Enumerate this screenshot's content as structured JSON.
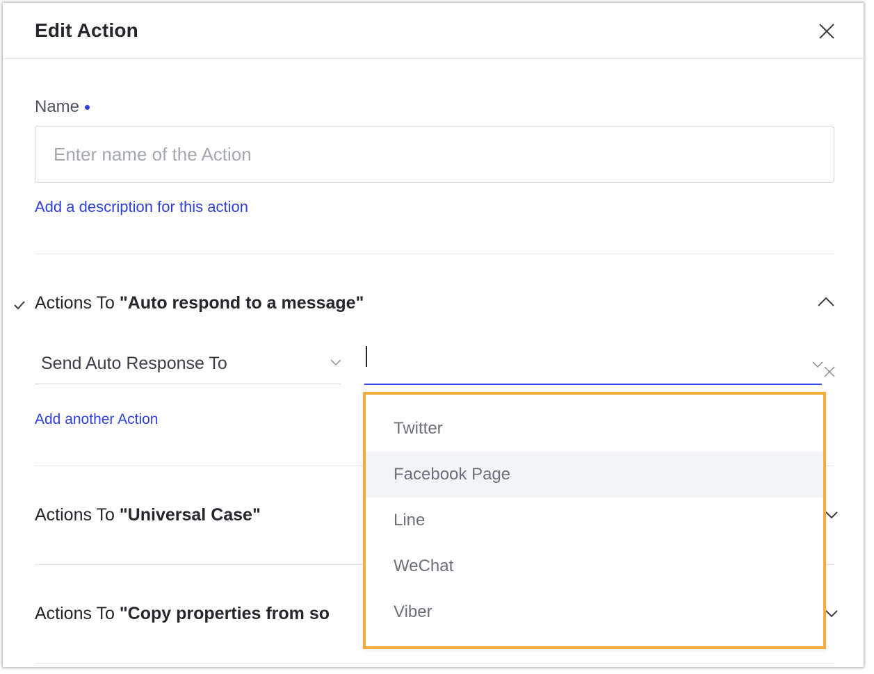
{
  "dialog": {
    "title": "Edit Action",
    "close_icon": "close-icon"
  },
  "name_field": {
    "label": "Name",
    "placeholder": "Enter name of the Action",
    "value": "",
    "required": true
  },
  "description_link": "Add a description for this action",
  "sections": [
    {
      "prefix": "Actions To ",
      "name": "\"Auto respond to a message\"",
      "expanded": true,
      "completed": true
    },
    {
      "prefix": "Actions To ",
      "name": "\"Universal Case\"",
      "expanded": false
    },
    {
      "prefix": "Actions To ",
      "name": "\"Copy properties from so",
      "expanded": false
    }
  ],
  "action_row": {
    "action_select_value": "Send Auto Response To",
    "target_select_value": ""
  },
  "add_action_link": "Add another Action",
  "dropdown": {
    "options": [
      "Twitter",
      "Facebook Page",
      "Line",
      "WeChat",
      "Viber"
    ],
    "hovered_option": "Facebook Page"
  },
  "colors": {
    "accent": "#2d3fe0",
    "highlight_border": "#f2ac3e",
    "hover_bg": "#f3f4f8"
  }
}
